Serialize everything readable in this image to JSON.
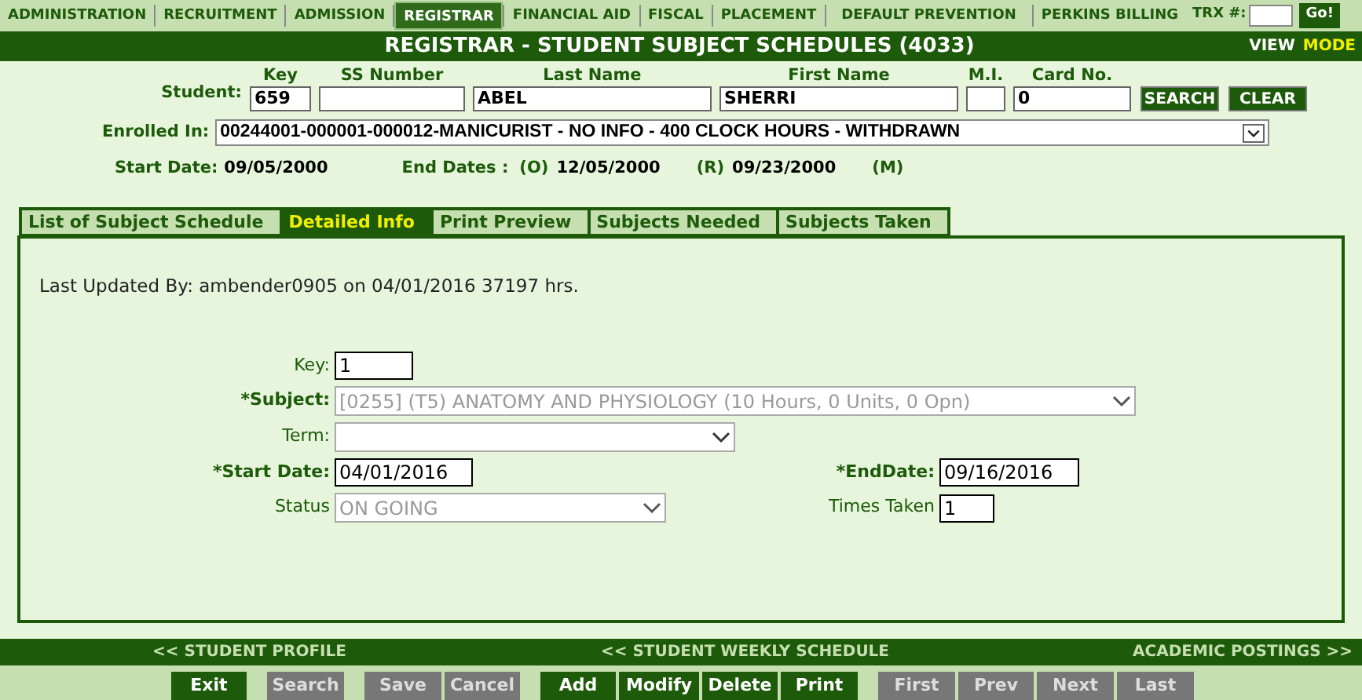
{
  "nav": {
    "items": [
      {
        "label": "ADMINISTRATION",
        "selected": false
      },
      {
        "label": "RECRUITMENT",
        "selected": false
      },
      {
        "label": "ADMISSION",
        "selected": false
      },
      {
        "label": "REGISTRAR",
        "selected": true
      },
      {
        "label": "FINANCIAL AID",
        "selected": false
      },
      {
        "label": "FISCAL",
        "selected": false
      },
      {
        "label": "PLACEMENT",
        "selected": false
      },
      {
        "label": "DEFAULT PREVENTION",
        "selected": false
      },
      {
        "label": "PERKINS BILLING",
        "selected": false
      }
    ],
    "trx_label": "TRX #:",
    "go_button": "Go!"
  },
  "header": {
    "title": "REGISTRAR - STUDENT SUBJECT SCHEDULES (4033)",
    "view": "VIEW",
    "mode": "MODE"
  },
  "student": {
    "label": "Student:",
    "fields": [
      {
        "heading": "Key",
        "value": "659"
      },
      {
        "heading": "SS Number"
      },
      {
        "heading": "Last Name",
        "value": "ABEL"
      },
      {
        "heading": "First Name",
        "value": "SHERRI"
      },
      {
        "heading": "M.I."
      },
      {
        "heading": "Card No.",
        "value": "0"
      }
    ],
    "buttons": [
      "SEARCH",
      "CLEAR"
    ]
  },
  "enrolled": {
    "label": "Enrolled In:",
    "value": "00244001-000001-000012-MANICURIST - NO INFO - 400 CLOCK HOURS - WITHDRAWN"
  },
  "dates": {
    "start_label": "Start Date:",
    "start": "09/05/2000",
    "end_label": "End Dates :",
    "o_label": "(O)",
    "o": "12/05/2000",
    "r_label": "(R)",
    "r": "09/23/2000",
    "m_label": "(M)"
  },
  "tabs": [
    {
      "label": "List of Subject Schedule",
      "selected": false
    },
    {
      "label": "Detailed Info",
      "selected": true
    },
    {
      "label": "Print Preview",
      "selected": false
    },
    {
      "label": "Subjects Needed",
      "selected": false
    },
    {
      "label": "Subjects Taken",
      "selected": false
    }
  ],
  "detail": {
    "last_updated": "Last Updated By: ambender0905 on 04/01/2016 37197 hrs.",
    "key": {
      "label": "Key:",
      "value": "1"
    },
    "subject": {
      "label": "*Subject:",
      "value": "[0255] (T5) ANATOMY AND PHYSIOLOGY (10 Hours, 0 Units, 0 Opn)",
      "disabled": true
    },
    "term": {
      "label": "Term:",
      "disabled": false
    },
    "start_date": {
      "label": "*Start Date:",
      "value": "04/01/2016"
    },
    "end_date": {
      "label": "*EndDate:",
      "value": "09/16/2016"
    },
    "status": {
      "label": "Status",
      "value": "ON GOING",
      "disabled": true
    },
    "times_taken": {
      "label": "Times Taken",
      "value": "1"
    }
  },
  "links": [
    "<< STUDENT PROFILE",
    "<< STUDENT WEEKLY SCHEDULE",
    "ACADEMIC POSTINGS >>"
  ],
  "button_groups": [
    [
      {
        "label": "Exit",
        "disabled": false
      }
    ],
    [
      {
        "label": "Search",
        "disabled": true
      }
    ],
    [
      {
        "label": "Save",
        "disabled": true
      },
      {
        "label": "Cancel",
        "disabled": true
      }
    ],
    [
      {
        "label": "Add",
        "disabled": false
      },
      {
        "label": "Modify",
        "disabled": false
      },
      {
        "label": "Delete",
        "disabled": false
      },
      {
        "label": "Print",
        "disabled": false
      }
    ],
    [
      {
        "label": "First",
        "disabled": true
      },
      {
        "label": "Prev",
        "disabled": true
      },
      {
        "label": "Next",
        "disabled": true
      },
      {
        "label": "Last",
        "disabled": true
      }
    ]
  ]
}
